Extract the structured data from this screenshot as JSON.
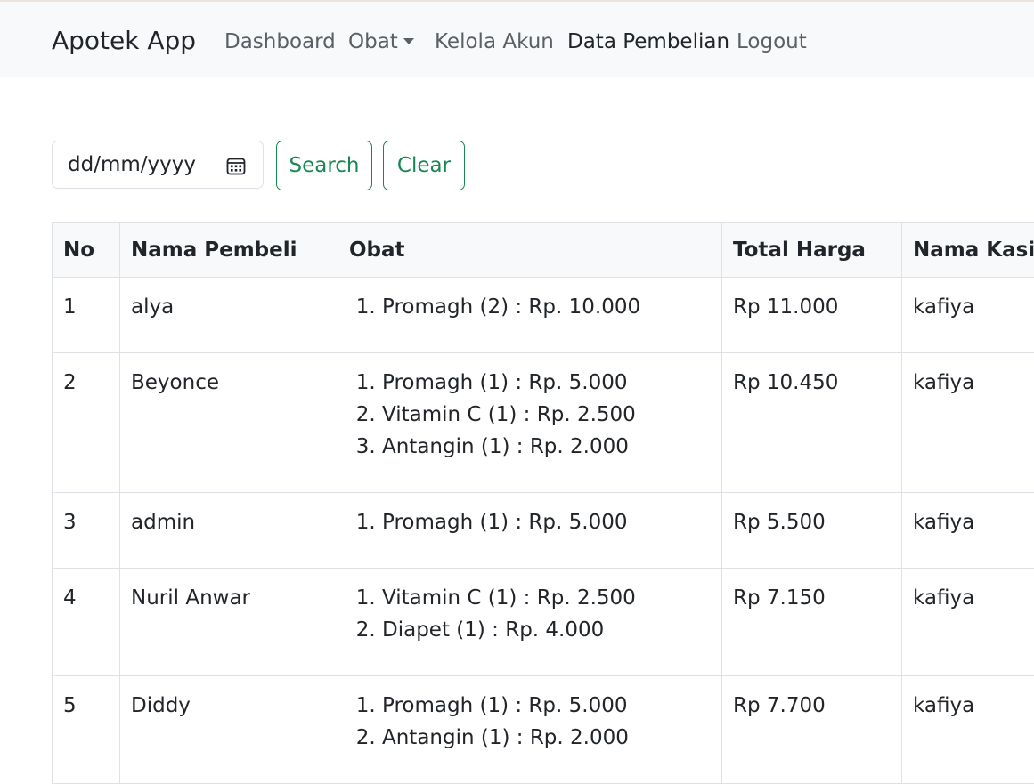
{
  "navbar": {
    "brand": "Apotek App",
    "links": [
      {
        "label": "Dashboard"
      },
      {
        "label": "Obat"
      },
      {
        "label": "Kelola Akun"
      },
      {
        "label": "Data Pembelian"
      },
      {
        "label": "Logout"
      }
    ]
  },
  "filter": {
    "date_placeholder": "dd/mm/yyyy",
    "search_label": "Search",
    "clear_label": "Clear"
  },
  "table": {
    "headers": [
      "No",
      "Nama Pembeli",
      "Obat",
      "Total Harga",
      "Nama Kasir"
    ],
    "rows": [
      {
        "no": "1",
        "buyer": "alya",
        "items": [
          "Promagh (2) : Rp. 10.000"
        ],
        "total": "Rp 11.000",
        "cashier": "kafiya"
      },
      {
        "no": "2",
        "buyer": "Beyonce",
        "items": [
          "Promagh (1) : Rp. 5.000",
          "Vitamin C (1) : Rp. 2.500",
          "Antangin (1) : Rp. 2.000"
        ],
        "total": "Rp 10.450",
        "cashier": "kafiya"
      },
      {
        "no": "3",
        "buyer": "admin",
        "items": [
          "Promagh (1) : Rp. 5.000"
        ],
        "total": "Rp 5.500",
        "cashier": "kafiya"
      },
      {
        "no": "4",
        "buyer": "Nuril Anwar",
        "items": [
          "Vitamin C (1) : Rp. 2.500",
          "Diapet (1) : Rp. 4.000"
        ],
        "total": "Rp 7.150",
        "cashier": "kafiya"
      },
      {
        "no": "5",
        "buyer": "Diddy",
        "items": [
          "Promagh (1) : Rp. 5.000",
          "Antangin (1) : Rp. 2.000"
        ],
        "total": "Rp 7.700",
        "cashier": "kafiya"
      }
    ]
  },
  "colors": {
    "accent": "#198754",
    "navbar_bg": "#f8f9fa",
    "border": "#dee2e6"
  }
}
